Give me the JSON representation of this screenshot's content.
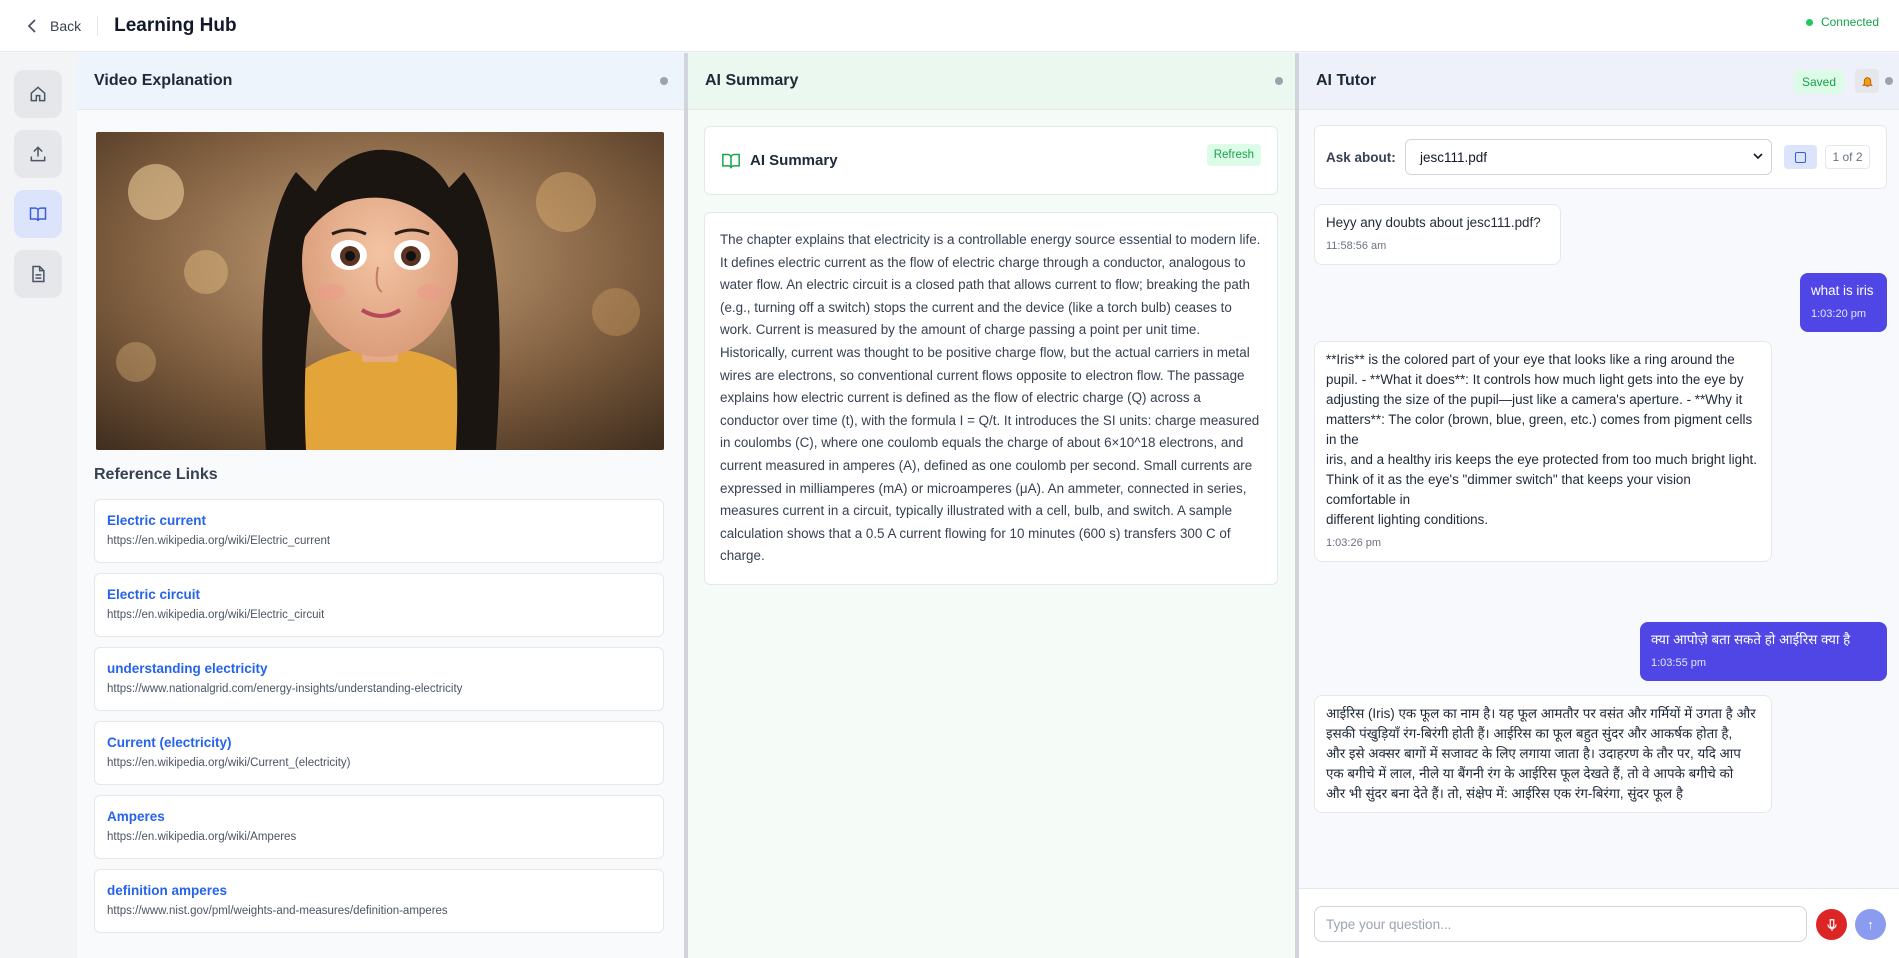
{
  "topbar": {
    "back_label": "Back",
    "app_title": "Learning Hub",
    "status": "Connected"
  },
  "rail": {
    "items": [
      "home-icon",
      "upload-icon",
      "book-icon",
      "document-icon"
    ],
    "active": "book-icon"
  },
  "video_panel": {
    "title": "Video Explanation",
    "ref_title": "Reference Links",
    "links": [
      {
        "title": "Electric current",
        "url": "https://en.wikipedia.org/wiki/Electric_current"
      },
      {
        "title": "Electric circuit",
        "url": "https://en.wikipedia.org/wiki/Electric_circuit"
      },
      {
        "title": "understanding electricity",
        "url": "https://www.nationalgrid.com/energy-insights/understanding-electricity"
      },
      {
        "title": "Current (electricity)",
        "url": "https://en.wikipedia.org/wiki/Current_(electricity)"
      },
      {
        "title": "Amperes",
        "url": "https://en.wikipedia.org/wiki/Amperes"
      },
      {
        "title": "definition amperes",
        "url": "https://www.nist.gov/pml/weights-and-measures/definition-amperes"
      }
    ]
  },
  "summary_panel": {
    "title": "AI Summary",
    "card_label": "AI Summary",
    "refresh_label": "Refresh",
    "text": "The chapter explains that electricity is a controllable energy source essential to modern life. It defines electric current as the flow of electric charge through a conductor, analogous to water flow. An electric circuit is a closed path that allows current to flow; breaking the path (e.g., turning off a switch) stops the current and the device (like a torch bulb) ceases to work. Current is measured by the amount of charge passing a point per unit time. Historically, current was thought to be positive charge flow, but the actual carriers in metal wires are electrons, so conventional current flows opposite to electron flow. The passage explains how electric current is defined as the flow of electric charge (Q) across a conductor over time (t), with the formula I = Q/t. It introduces the SI units: charge measured in coulombs (C), where one coulomb equals the charge of about 6×10^18 electrons, and current measured in amperes (A), defined as one coulomb per second. Small currents are expressed in milliamperes (mA) or microamperes (μA). An ammeter, connected in series, measures current in a circuit, typically illustrated with a cell, bulb, and switch. A sample calculation shows that a 0.5 A current flowing for 10 minutes (600 s) transfers 300 C of charge."
  },
  "tutor_panel": {
    "title": "AI Tutor",
    "saved_label": "Saved",
    "ask_label": "Ask about:",
    "selected_file": "jesc111.pdf",
    "page_count": "1 of 2",
    "input_placeholder": "Type your question...",
    "send_icon": "↑",
    "messages": [
      {
        "role": "bot",
        "text": "Heyy any doubts about jesc111.pdf?",
        "time": "11:58:56 am"
      },
      {
        "role": "user",
        "text": "what is iris",
        "time": "1:03:20 pm"
      },
      {
        "role": "bot",
        "text": "**Iris** is the colored part of your eye that looks like a ring around the pupil.    - **What it does**: It controls how much light gets into the eye by\nadjusting the size of the pupil—just like a camera's aperture.   - **Why it\nmatters**: The color (brown, blue, green, etc.) comes from pigment cells in the\niris, and a healthy iris keeps the eye protected from too much bright light.\nThink of it as the eye's \"dimmer switch\" that keeps your vision comfortable in\ndifferent lighting conditions.",
        "time": "1:03:26 pm"
      },
      {
        "role": "user",
        "text": "क्या आपोज़े बता सकते हो आईरिस क्या है",
        "time": "1:03:55 pm"
      },
      {
        "role": "bot",
        "text": "आईरिस (Iris) एक फूल का नाम है। यह फूल आमतौर पर वसंत और गर्मियों में उगता है और\nइसकी पंखुड़ियाँ रंग-बिरंगी होती हैं। आईरिस का फूल बहुत सुंदर और आकर्षक होता है,\nऔर इसे अक्सर बागों में सजावट के लिए लगाया जाता है।    उदाहरण के तौर पर, यदि आप\nएक बगीचे में लाल, नीले या बैंगनी रंग के आईरिस फूल देखते हैं, तो वे आपके बगीचे को\nऔर भी सुंदर बना देते हैं।    तो, संक्षेप में: आईरिस एक रंग-बिरंगा, सुंदर फूल है",
        "time": ""
      }
    ]
  },
  "colors": {
    "accent": "#4f46e5",
    "success": "#16a34a",
    "link": "#2563eb",
    "mic": "#dc2626"
  }
}
